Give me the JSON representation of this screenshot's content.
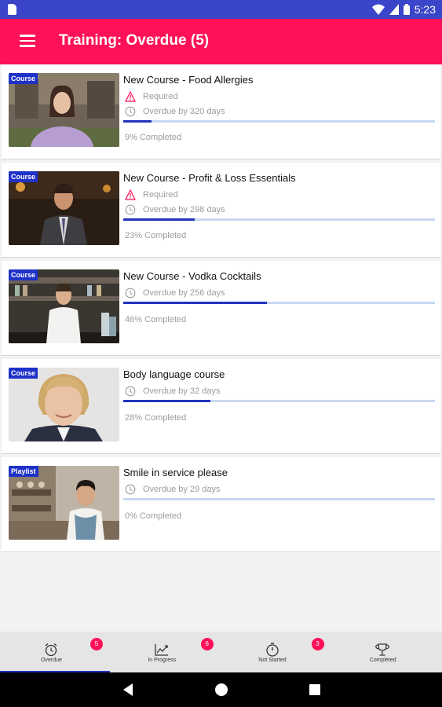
{
  "status_bar": {
    "time": "5:23"
  },
  "app_bar": {
    "title": "Training: Overdue (5)"
  },
  "courses": [
    {
      "tag": "Course",
      "title": "New Course - Food Allergies",
      "required": "Required",
      "overdue": "Overdue by 320 days",
      "progress": 9,
      "completed": "9% Completed"
    },
    {
      "tag": "Course",
      "title": "New Course - Profit & Loss Essentials",
      "required": "Required",
      "overdue": "Overdue by 298 days",
      "progress": 23,
      "completed": "23% Completed"
    },
    {
      "tag": "Course",
      "title": "New Course - Vodka Cocktails",
      "required": "",
      "overdue": "Overdue by 256 days",
      "progress": 46,
      "completed": "46% Completed"
    },
    {
      "tag": "Course",
      "title": "Body language course",
      "required": "",
      "overdue": "Overdue by 32 days",
      "progress": 28,
      "completed": "28% Completed"
    },
    {
      "tag": "Playlist",
      "title": "Smile in service please",
      "required": "",
      "overdue": "Overdue by 29 days",
      "progress": 0,
      "completed": "0% Completed"
    }
  ],
  "bottom_nav": [
    {
      "label": "Overdue",
      "badge": "5",
      "icon": "alarm-clock-icon",
      "active": true
    },
    {
      "label": "In Progress",
      "badge": "6",
      "icon": "trending-chart-icon",
      "active": false
    },
    {
      "label": "Not Started",
      "badge": "3",
      "icon": "stopwatch-icon",
      "active": false
    },
    {
      "label": "Completed",
      "badge": "",
      "icon": "trophy-icon",
      "active": false
    }
  ],
  "colors": {
    "brand": "#ff1157",
    "status_bar": "#3b45c9",
    "accent": "#2233bd",
    "track": "#c9d8f3"
  }
}
